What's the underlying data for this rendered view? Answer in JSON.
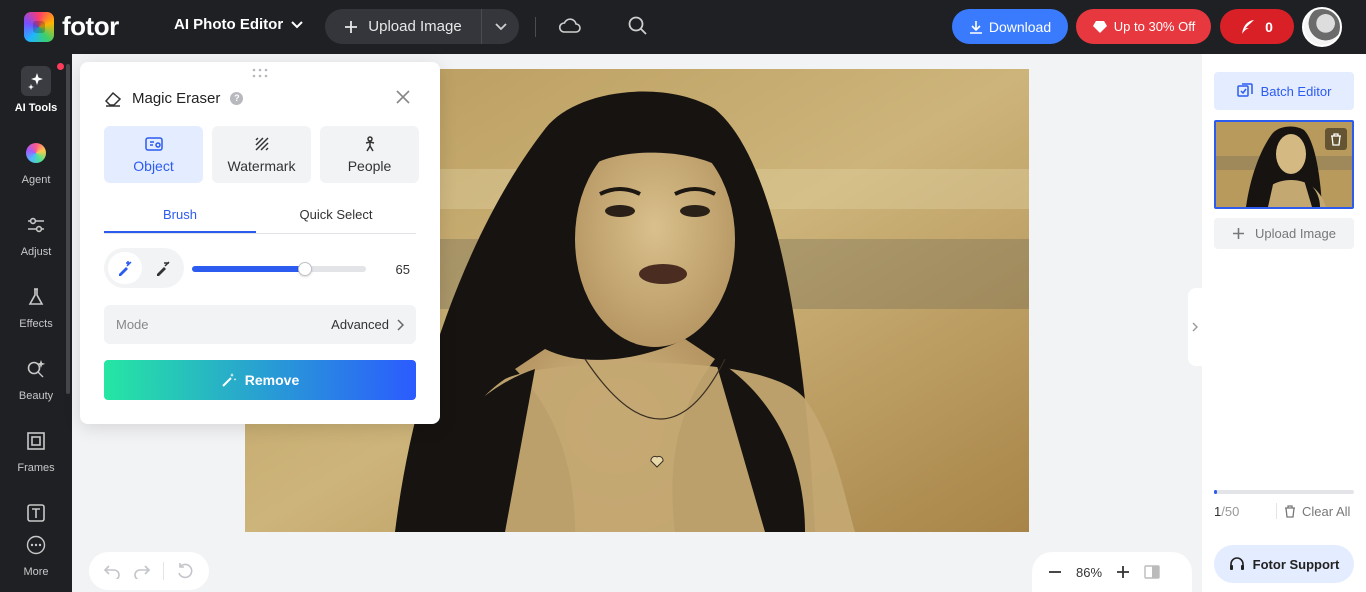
{
  "brand": {
    "name": "fotor"
  },
  "header": {
    "editor_menu": "AI Photo Editor",
    "upload_label": "Upload Image",
    "download_label": "Download",
    "promo_label": "Up to 30% Off",
    "credits": "0"
  },
  "sidebar": {
    "items": [
      {
        "label": "AI Tools",
        "icon": "sparkle-icon"
      },
      {
        "label": "Agent",
        "icon": "agent-orb-icon"
      },
      {
        "label": "Adjust",
        "icon": "sliders-icon"
      },
      {
        "label": "Effects",
        "icon": "flask-icon"
      },
      {
        "label": "Beauty",
        "icon": "beauty-icon"
      },
      {
        "label": "Frames",
        "icon": "frame-icon"
      },
      {
        "label": "Text",
        "icon": "text-icon"
      },
      {
        "label": "More",
        "icon": "more-icon"
      }
    ]
  },
  "panel": {
    "title": "Magic Eraser",
    "modes": [
      {
        "label": "Object",
        "active": true
      },
      {
        "label": "Watermark",
        "active": false
      },
      {
        "label": "People",
        "active": false
      }
    ],
    "tabs": [
      {
        "label": "Brush",
        "active": true
      },
      {
        "label": "Quick Select",
        "active": false
      }
    ],
    "brush_size": 65,
    "brush_size_max": 100,
    "mode_label": "Mode",
    "mode_value": "Advanced",
    "remove_label": "Remove"
  },
  "zoom": {
    "level": "86%"
  },
  "right_panel": {
    "batch_label": "Batch Editor",
    "upload_label": "Upload Image",
    "count_current": "1",
    "count_total": "/50",
    "progress_fraction": 0.02,
    "clear_label": "Clear All",
    "support_label": "Fotor Support"
  },
  "colors": {
    "accent": "#2c5bf0",
    "download": "#3a7bfd",
    "promo": "#e8383f",
    "topbar": "#1f2024"
  }
}
